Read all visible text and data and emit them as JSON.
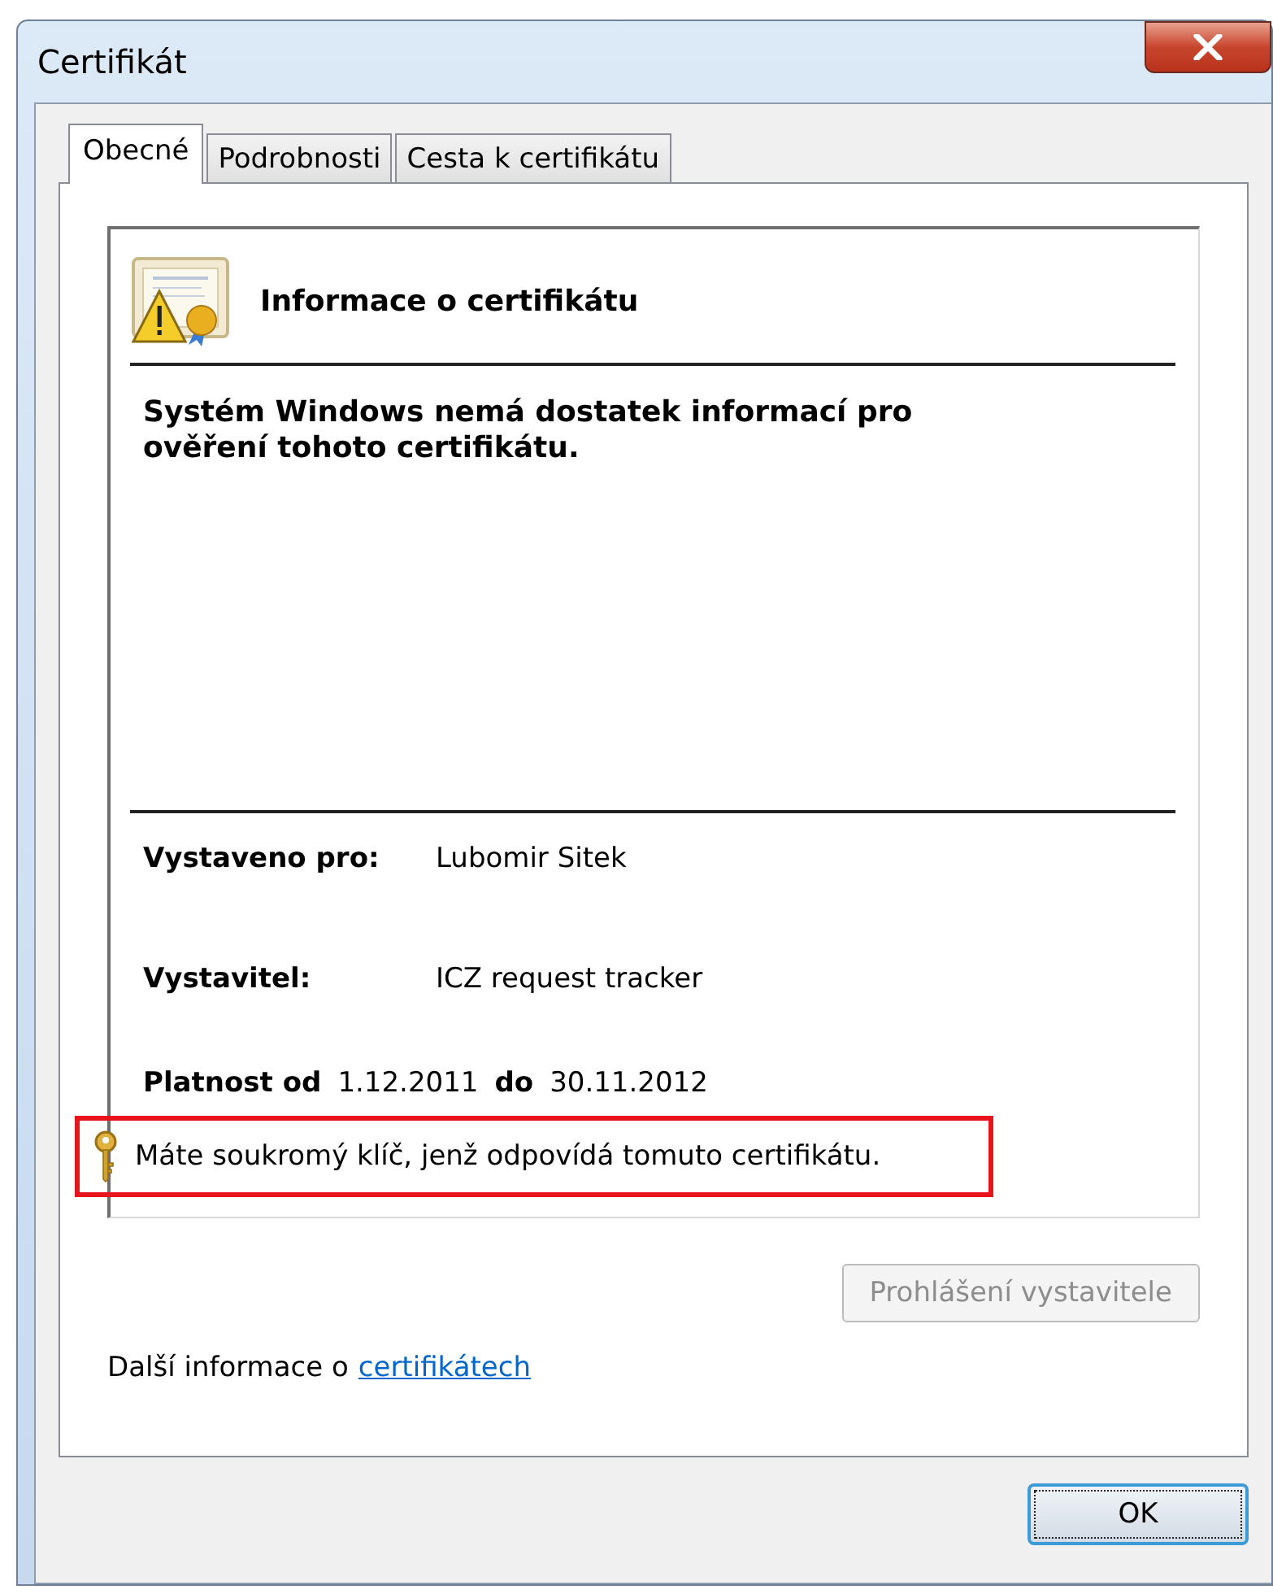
{
  "window": {
    "title": "Certifikát"
  },
  "tabs": [
    {
      "label": "Obecné",
      "selected": true
    },
    {
      "label": "Podrobnosti",
      "selected": false
    },
    {
      "label": "Cesta k certifikátu",
      "selected": false
    }
  ],
  "info": {
    "heading": "Informace o certifikátu",
    "message": "Systém Windows nemá dostatek informací pro ověření tohoto certifikátu."
  },
  "fields": [
    {
      "label": "Vystaveno pro:",
      "value": "Lubomir Sitek"
    },
    {
      "label": "Vystavitel:",
      "value": "ICZ request tracker"
    }
  ],
  "validity": {
    "from_label": "Platnost od",
    "from": "1.12.2011",
    "to_label": "do",
    "to": "30.11.2012"
  },
  "private_key": {
    "text": "Máte soukromý klíč, jenž odpovídá tomuto certifikátu.",
    "highlighted": true
  },
  "issuer_statement_button": {
    "label": "Prohlášení vystavitele",
    "disabled": true
  },
  "more_info": {
    "text": "Další informace o",
    "link": "certifikátech"
  },
  "buttons": [
    {
      "label": "OK",
      "focused": true
    }
  ]
}
